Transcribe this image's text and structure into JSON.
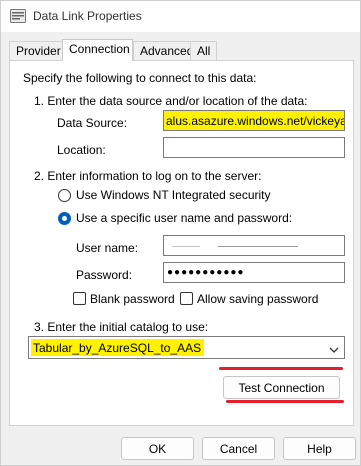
{
  "window": {
    "title": "Data Link Properties",
    "icon": "data-link-icon"
  },
  "tabs": [
    {
      "label": "Provider",
      "active": false
    },
    {
      "label": "Connection",
      "active": true
    },
    {
      "label": "Advanced",
      "active": false
    },
    {
      "label": "All",
      "active": false
    }
  ],
  "connection": {
    "intro": "Specify the following to connect to this data:",
    "step1": "1. Enter the data source and/or location of the data:",
    "data_source_label": "Data Source:",
    "data_source_value": "alus.asazure.windows.net/vickeyaas",
    "location_label": "Location:",
    "location_value": "",
    "step2": "2. Enter information to log on to the server:",
    "radio_nt": "Use Windows NT Integrated security",
    "radio_specific": "Use a specific user name and password:",
    "radio_nt_checked": false,
    "radio_specific_checked": true,
    "user_name_label": "User name:",
    "password_label": "Password:",
    "password_value": "●●●●●●●●●●●",
    "blank_password_label": "Blank password",
    "blank_password_checked": false,
    "allow_saving_label": "Allow saving password",
    "allow_saving_checked": false,
    "step3": "3. Enter the initial catalog to use:",
    "catalog_value": "Tabular_by_AzureSQL_to_AAS",
    "test_connection_label": "Test Connection"
  },
  "footer": {
    "ok_label": "OK",
    "cancel_label": "Cancel",
    "help_label": "Help"
  },
  "colors": {
    "highlight": "#fff200",
    "annotation_red": "#e41e2b",
    "radio_selected": "#005fb8"
  }
}
